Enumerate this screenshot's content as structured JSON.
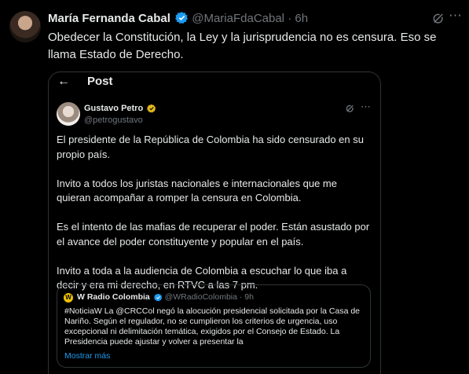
{
  "tweet": {
    "author_name": "María Fernanda Cabal",
    "handle": "@MariaFdaCabal",
    "separator": "·",
    "time": "6h",
    "text": "Obedecer la Constitución, la Ley y la jurisprudencia no es censura. Eso se llama Estado de Derecho."
  },
  "embed": {
    "header": {
      "back_icon": "arrow-left-icon",
      "title": "Post"
    },
    "author_name": "Gustavo Petro",
    "handle": "@petrogustavo",
    "paragraphs": [
      "El presidente de la República de Colombia  ha sido censurado en su propio  país.",
      "Invito a todos los juristas nacionales e internacionales que me quieran acompañar a romper la censura en Colombia.",
      "Es el intento de las mafias de recuperar el poder. Están asustado por el avance del poder constituyente y popular en el país.",
      "Invito a toda a la audiencia de Colombia a escuchar lo que iba a decir y era mi derecho, en RTVC a las 7 pm."
    ],
    "quote": {
      "logo_letter": "W",
      "author_name": "W Radio Colombia",
      "handle": "@WRadioColombia",
      "separator": "·",
      "time": "9h",
      "text": "#NoticiaW La @CRCCol negó la alocución presidencial solicitada por la Casa de Nariño. Según el regulador, no se cumplieron los criterios de urgencia, uso excepcional ni delimitación temática, exigidos por el Consejo de Estado. La Presidencia puede ajustar y volver a presentar la",
      "show_more": "Mostrar más"
    }
  },
  "colors": {
    "background": "#000000",
    "text": "#e7e9ea",
    "muted": "#71767b",
    "accent_blue": "#1d9bf0",
    "verified_gold": "#e2b719",
    "border": "#2f3336"
  },
  "icons": [
    "verified-badge-icon",
    "grok-icon",
    "more-icon",
    "arrow-left-icon"
  ]
}
